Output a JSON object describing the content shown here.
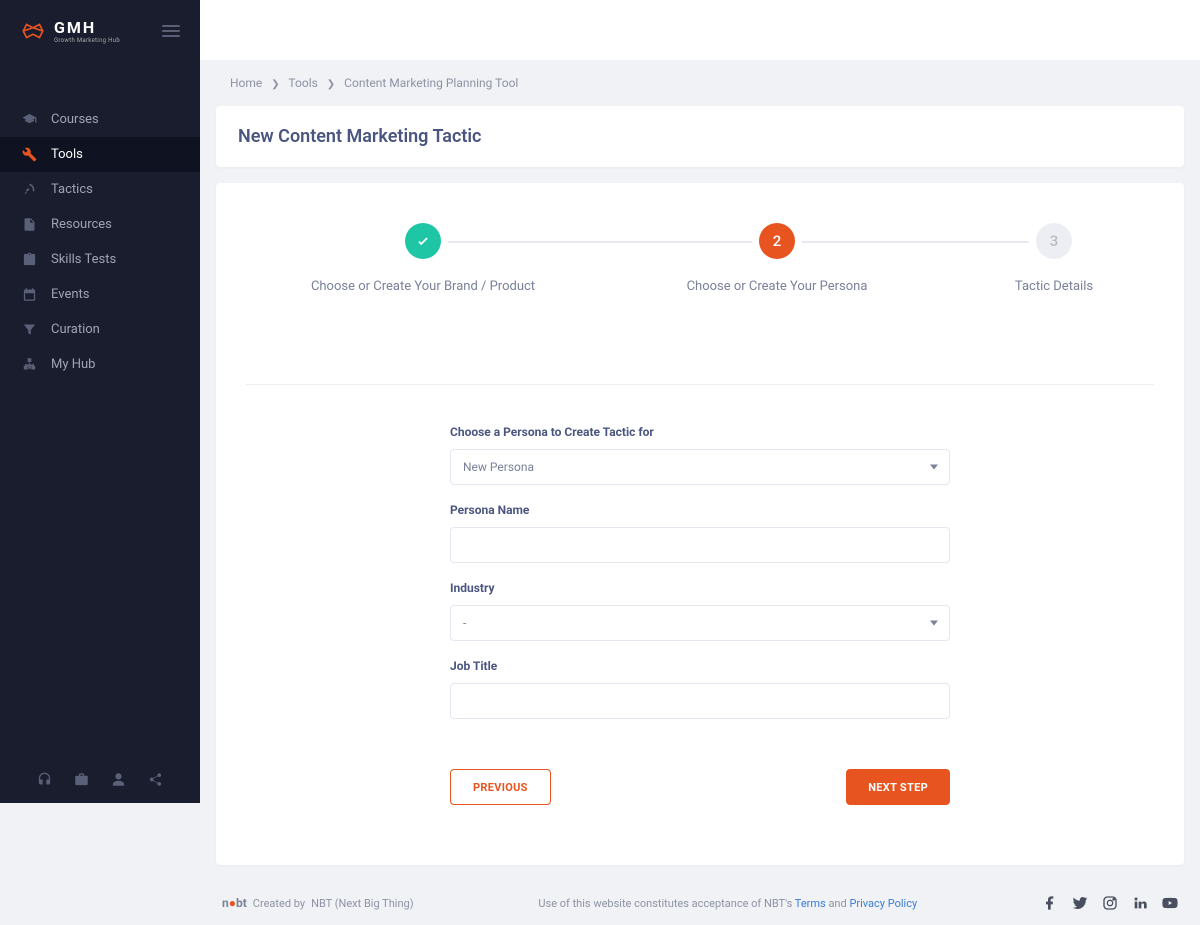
{
  "brand": {
    "name": "GMH",
    "tagline": "Growth Marketing Hub"
  },
  "sidebar": {
    "items": [
      {
        "label": "Courses",
        "icon": "graduation"
      },
      {
        "label": "Tools",
        "icon": "tools"
      },
      {
        "label": "Tactics",
        "icon": "rocket"
      },
      {
        "label": "Resources",
        "icon": "file"
      },
      {
        "label": "Skills Tests",
        "icon": "clipboard"
      },
      {
        "label": "Events",
        "icon": "calendar"
      },
      {
        "label": "Curation",
        "icon": "funnel"
      },
      {
        "label": "My Hub",
        "icon": "sitemap"
      }
    ],
    "active_index": 1
  },
  "breadcrumb": [
    {
      "label": "Home"
    },
    {
      "label": "Tools"
    },
    {
      "label": "Content Marketing Planning Tool"
    }
  ],
  "page": {
    "title": "New Content Marketing Tactic"
  },
  "wizard": {
    "steps": [
      {
        "label": "Choose or Create Your Brand / Product",
        "state": "done"
      },
      {
        "label": "Choose or Create Your Persona",
        "state": "active",
        "number": "2"
      },
      {
        "label": "Tactic Details",
        "state": "pending",
        "number": "3"
      }
    ]
  },
  "form": {
    "persona_select": {
      "label": "Choose a Persona to Create Tactic for",
      "value": "New Persona"
    },
    "persona_name": {
      "label": "Persona Name",
      "value": ""
    },
    "industry": {
      "label": "Industry",
      "value": "-"
    },
    "job_title": {
      "label": "Job Title",
      "value": ""
    }
  },
  "buttons": {
    "previous": "PREVIOUS",
    "next": "NEXT STEP"
  },
  "footer": {
    "created_by_prefix": "Created by",
    "created_by_name": "NBT (Next Big Thing)",
    "legal_prefix": "Use of this website constitutes acceptance of NBT's ",
    "terms": "Terms",
    "and": " and ",
    "privacy": "Privacy Policy"
  }
}
